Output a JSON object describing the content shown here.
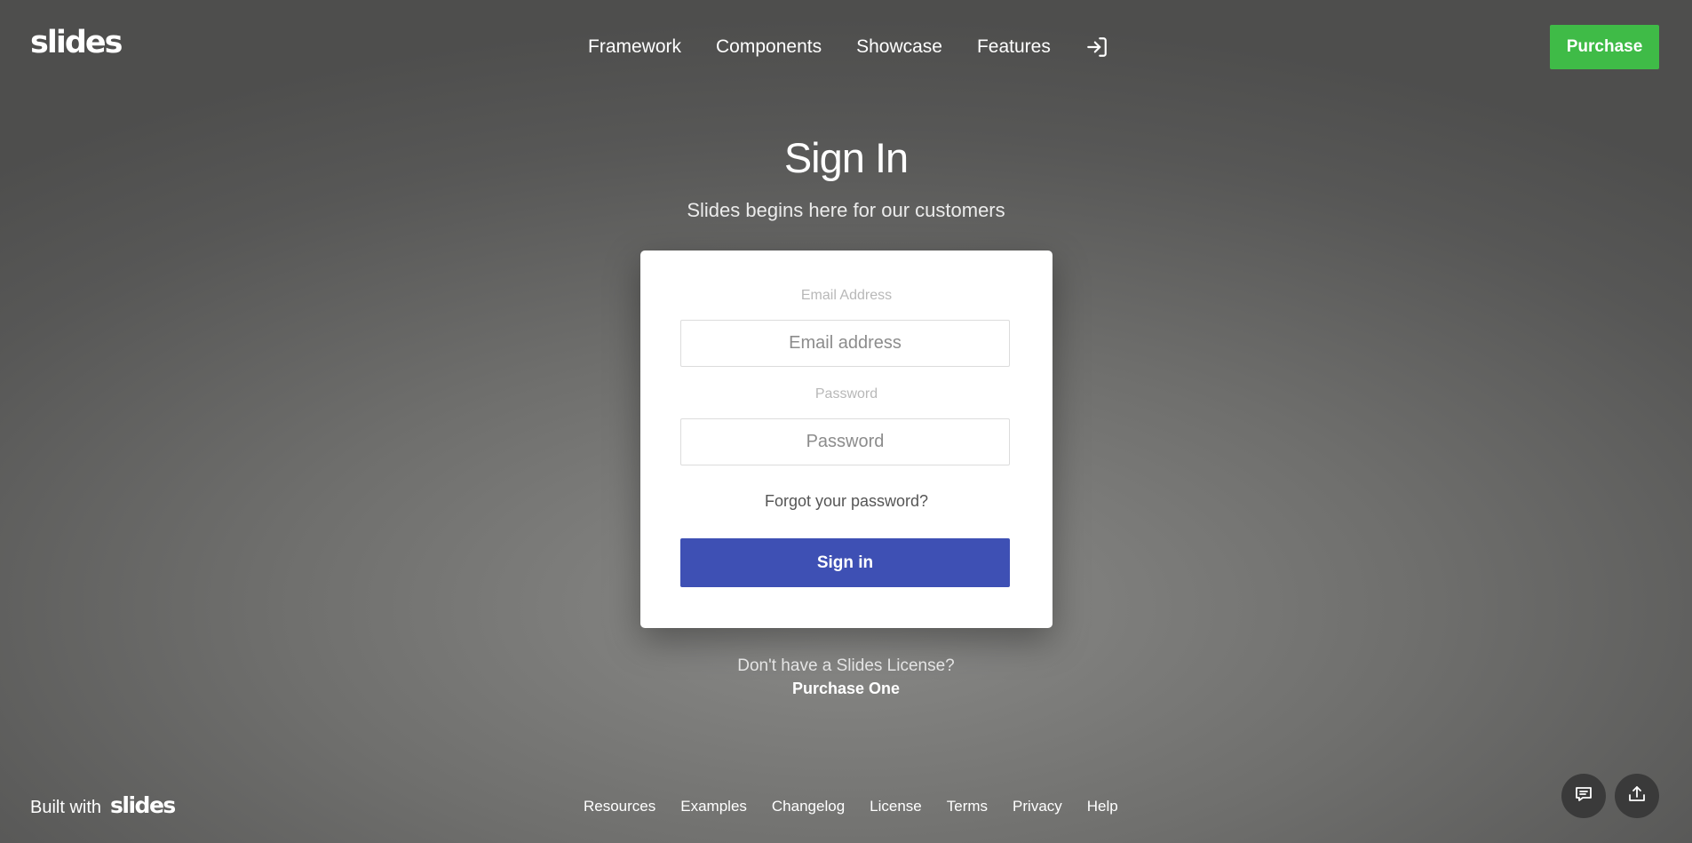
{
  "header": {
    "logo": "slides",
    "nav": [
      "Framework",
      "Components",
      "Showcase",
      "Features"
    ],
    "login_icon": "sign-in-icon",
    "purchase_label": "Purchase"
  },
  "main": {
    "title": "Sign In",
    "subtitle": "Slides begins here for our customers",
    "form": {
      "email_label": "Email Address",
      "email_placeholder": "Email address",
      "password_label": "Password",
      "password_placeholder": "Password",
      "forgot_label": "Forgot your password?",
      "signin_label": "Sign in"
    },
    "no_license_text": "Don't have a Slides License?",
    "purchase_one_label": "Purchase One"
  },
  "footer": {
    "built_with": "Built with",
    "built_with_logo": "slides",
    "links": [
      "Resources",
      "Examples",
      "Changelog",
      "License",
      "Terms",
      "Privacy",
      "Help"
    ],
    "chat_icon": "chat-icon",
    "share_icon": "share-icon"
  },
  "colors": {
    "purchase_button": "#3fbb47",
    "signin_button": "#3e50b4"
  }
}
